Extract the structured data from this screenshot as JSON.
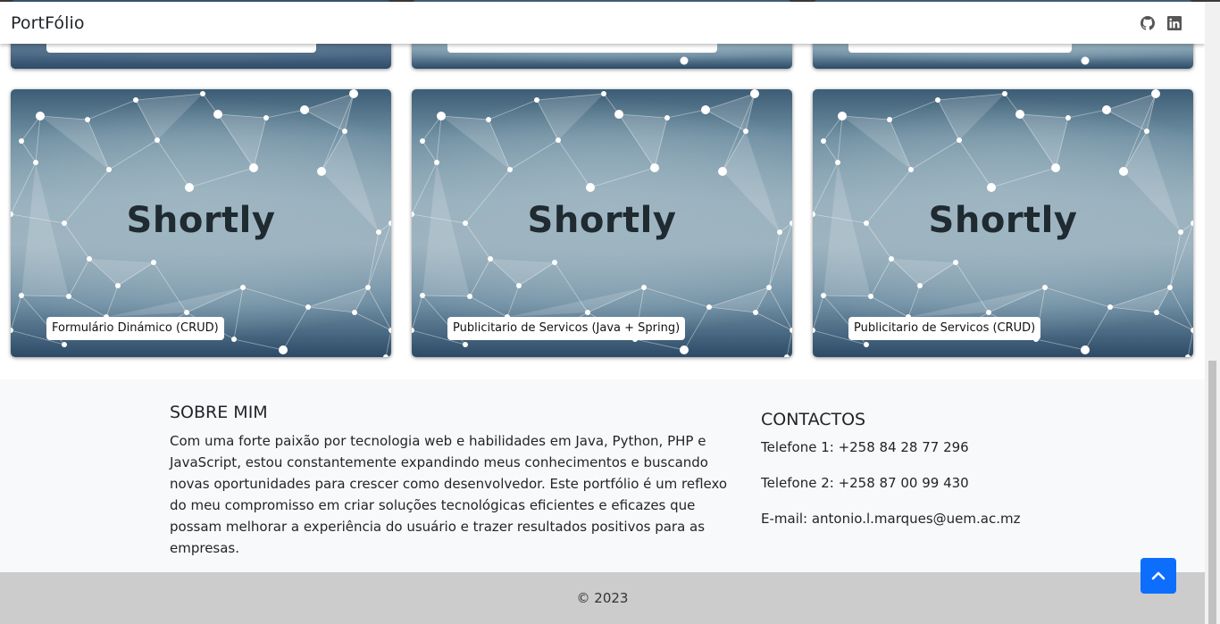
{
  "navbar": {
    "brand": "PortFólio",
    "icons": [
      "github-icon",
      "linkedin-icon"
    ]
  },
  "projects": [
    {
      "title": "Shortly",
      "label": "Formulário Dinámico (CRUD)"
    },
    {
      "title": "Shortly",
      "label": "Publicitario de Servicos (Java + Spring)"
    },
    {
      "title": "Shortly",
      "label": "Publicitario de Servicos (CRUD)"
    }
  ],
  "about": {
    "title": "SOBRE MIM",
    "text": "Com uma forte paixão por tecnologia web e habilidades em Java, Python, PHP e JavaScript, estou constantemente expandindo meus conhecimentos e buscando novas oportunidades para crescer como desenvolvedor. Este portfólio é um reflexo do meu compromisso em criar soluções tecnológicas eficientes e eficazes que possam melhorar a experiência do usuário e trazer resultados positivos para as empresas."
  },
  "contacts": {
    "title": "CONTACTOS",
    "phone1": "Telefone 1: +258 84 28 77 296",
    "phone2": "Telefone 2: +258 87 00 99 430",
    "email": "E-mail: antonio.l.marques@uem.ac.mz"
  },
  "footer": {
    "copyright": "© 2023"
  },
  "back_to_top": {
    "icon": "chevron-up-icon"
  },
  "colors": {
    "accent": "#0d6efd",
    "footer_bg": "#cccccc",
    "section_bg": "#f8f9fa"
  }
}
